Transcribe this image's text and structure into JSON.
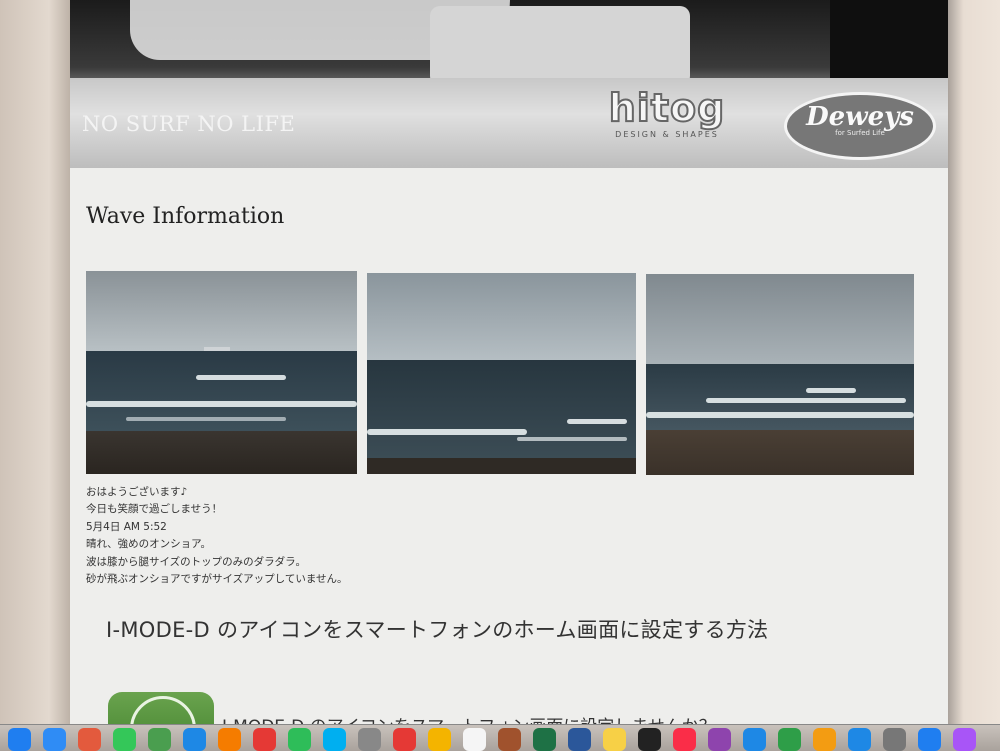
{
  "header": {
    "slogan": "NO SURF NO LIFE",
    "logos": [
      {
        "name": "hitog",
        "word": "hitog",
        "sub": "DESIGN & SHAPES"
      },
      {
        "name": "deweys",
        "word": "Deweys",
        "sub": "for Surfed Life"
      }
    ]
  },
  "section": {
    "title": "Wave Information"
  },
  "photos": [
    {
      "alt": "beach photo 1"
    },
    {
      "alt": "beach photo 2"
    },
    {
      "alt": "beach photo 3"
    }
  ],
  "post": {
    "lines": [
      "おはようございます♪",
      "今日も笑顔で過ごしませう！",
      "5月4日 AM 5:52",
      "晴れ、強めのオンショア。",
      "波は膝から腿サイズのトップのみのダラダラ。",
      "砂が飛ぶオンショアですがサイズアップしていません。"
    ]
  },
  "article": {
    "title": "I-MODE-D のアイコンをスマートフォンのホーム画面に設定する方法",
    "subtitle": "I-MODE-D のアイコンをスマートフォン画面に設定しませんか？"
  },
  "dock": {
    "icons": [
      "finder-icon",
      "mail-icon",
      "launchpad-icon",
      "messages-icon",
      "maps-icon",
      "safari-icon",
      "firefox-icon",
      "chrome-icon",
      "facetime-icon",
      "skype-icon",
      "settings-icon",
      "chrome-icon",
      "photos-icon",
      "calendar-icon",
      "app-icon",
      "excel-icon",
      "word-icon",
      "notes-icon",
      "tv-icon",
      "music-icon",
      "podcasts-icon",
      "keynote-icon",
      "numbers-icon",
      "pages-icon",
      "appstore-icon",
      "system-prefs-icon",
      "finder-icon",
      "messenger-icon"
    ],
    "colors": [
      "#1f7ef0",
      "#2f8cf5",
      "#e35a3d",
      "#34c759",
      "#4a9e4f",
      "#1e88e5",
      "#f57c00",
      "#e53935",
      "#2ebd59",
      "#00aff0",
      "#888888",
      "#e53935",
      "#f4b400",
      "#f5f5f5",
      "#a0522d",
      "#1e7145",
      "#2b579a",
      "#f7d046",
      "#222222",
      "#fa2d48",
      "#8e44ad",
      "#1e88e5",
      "#2e9e48",
      "#f39c12",
      "#1e88e5",
      "#777777",
      "#1f7ef0",
      "#a855f7"
    ]
  }
}
